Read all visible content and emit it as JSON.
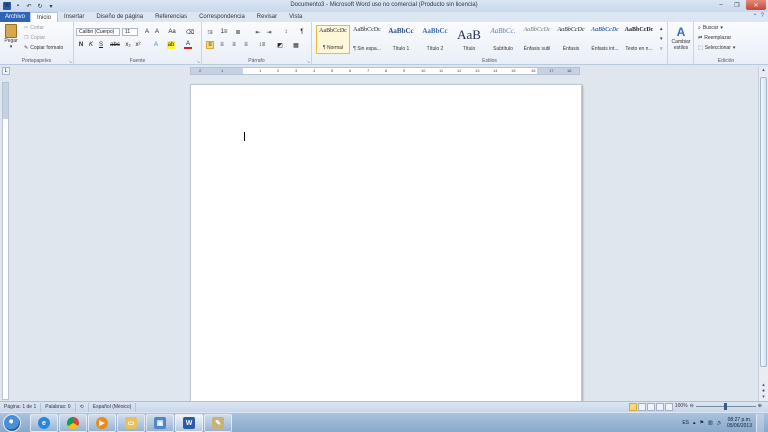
{
  "titlebar": {
    "title": "Documento3 - Microsoft Word uso no comercial (Producto sin licencia)",
    "qat_icons": [
      "word-logo-icon",
      "save-icon",
      "undo-icon",
      "redo-icon",
      "customize-qat-icon"
    ],
    "controls": {
      "minimize": "–",
      "maximize": "❐",
      "close": "✕"
    }
  },
  "tabs": [
    "Archivo",
    "Inicio",
    "Insertar",
    "Diseño de página",
    "Referencias",
    "Correspondencia",
    "Revisar",
    "Vista"
  ],
  "ribbon": {
    "clipboard": {
      "label": "Portapapeles",
      "paste": "Pegar",
      "cut": "Cortar",
      "copy": "Copiar",
      "format_painter": "Copiar formato"
    },
    "font": {
      "label": "Fuente",
      "font_name": "Calibri (Cuerpo)",
      "font_size": "11"
    },
    "paragraph": {
      "label": "Párrafo"
    },
    "styles": {
      "label": "Estilos",
      "items": [
        {
          "preview": "AaBbCcDc",
          "name": "¶ Normal"
        },
        {
          "preview": "AaBbCcDc",
          "name": "¶ Sin espa..."
        },
        {
          "preview": "AaBbCc",
          "name": "Título 1"
        },
        {
          "preview": "AaBbCc",
          "name": "Título 2"
        },
        {
          "preview": "AaB",
          "name": "Título"
        },
        {
          "preview": "AaBbCc.",
          "name": "Subtítulo"
        },
        {
          "preview": "AaBbCcDc",
          "name": "Énfasis sutil"
        },
        {
          "preview": "AaBbCcDc",
          "name": "Énfasis"
        },
        {
          "preview": "AaBbCcDc",
          "name": "Énfasis int..."
        },
        {
          "preview": "AaBbCcDc",
          "name": "Texto en n..."
        }
      ],
      "change_styles": "Cambiar estilos"
    },
    "editing": {
      "label": "Edición",
      "find": "Buscar",
      "replace": "Reemplazar",
      "select": "Seleccionar"
    }
  },
  "ruler_numbers": [
    "2",
    "1",
    "1",
    "2",
    "3",
    "4",
    "5",
    "6",
    "7",
    "8",
    "9",
    "10",
    "11",
    "12",
    "13",
    "14",
    "15",
    "16",
    "17",
    "18"
  ],
  "statusbar": {
    "page": "Página: 1 de 1",
    "words": "Palabras: 0",
    "language": "Español (México)",
    "zoom": "100%"
  },
  "taskbar": {
    "apps": [
      "internet-explorer",
      "chrome",
      "media-player",
      "file-explorer",
      "photo-viewer",
      "word",
      "paint"
    ],
    "lang": "ES",
    "time": "08:27 p.m.",
    "date": "05/06/2013"
  },
  "colors": {
    "file_tab": "#2f63b6",
    "word_blue": "#2a5aa8",
    "selected_style": "#e8b94a"
  }
}
